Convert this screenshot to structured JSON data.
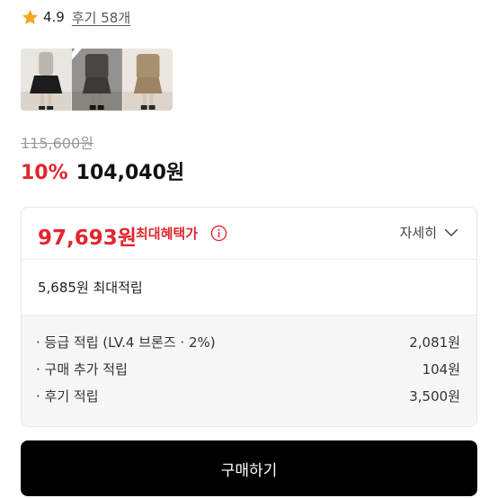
{
  "rating": {
    "score": "4.9",
    "review_link": "후기 58개",
    "star_color": "#f5a623"
  },
  "thumbnails": [
    {
      "name": "black-skirt-outfit",
      "selected": false
    },
    {
      "name": "grey-blazer-outfit",
      "selected": true
    },
    {
      "name": "beige-blazer-outfit",
      "selected": false
    }
  ],
  "pricing": {
    "original_price": "115,600원",
    "discount_rate": "10%",
    "sale_price": "104,040원",
    "accent_color": "#e0262d"
  },
  "benefit": {
    "max_price": "97,693원",
    "max_price_label": "최대혜택가",
    "detail_label": "자세히",
    "points_title": "5,685원 최대적립",
    "points": [
      {
        "label": "· 등급 적립 (LV.4 브론즈 · 2%)",
        "value": "2,081원"
      },
      {
        "label": "· 구매 추가 적립",
        "value": "104원"
      },
      {
        "label": "· 후기 적립",
        "value": "3,500원"
      }
    ]
  },
  "buy_button": {
    "label": "구매하기"
  }
}
